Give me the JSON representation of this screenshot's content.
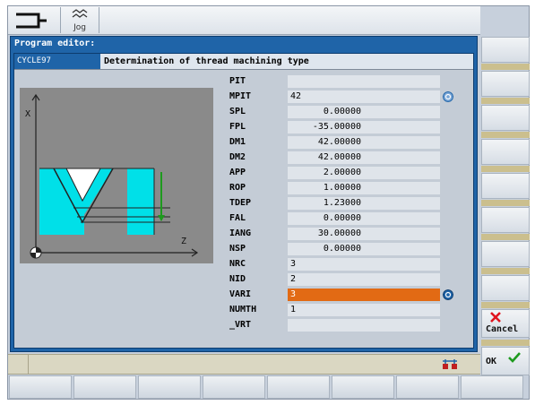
{
  "header": {
    "mode_label": "Jog"
  },
  "dialog": {
    "title": "Program editor:"
  },
  "cycle": {
    "name": "CYCLE97",
    "description": "Determination of thread machining type"
  },
  "params": [
    {
      "label": "PIT",
      "value": ""
    },
    {
      "label": "MPIT",
      "value": "42",
      "toggle": true
    },
    {
      "label": "SPL",
      "value": "0.00000",
      "numeric": true
    },
    {
      "label": "FPL",
      "value": "-35.00000",
      "numeric": true
    },
    {
      "label": "DM1",
      "value": "42.00000",
      "numeric": true
    },
    {
      "label": "DM2",
      "value": "42.00000",
      "numeric": true
    },
    {
      "label": "APP",
      "value": "2.00000",
      "numeric": true
    },
    {
      "label": "ROP",
      "value": "1.00000",
      "numeric": true
    },
    {
      "label": "TDEP",
      "value": "1.23000",
      "numeric": true
    },
    {
      "label": "FAL",
      "value": "0.00000",
      "numeric": true
    },
    {
      "label": "IANG",
      "value": "30.00000",
      "numeric": true
    },
    {
      "label": "NSP",
      "value": "0.00000",
      "numeric": true
    },
    {
      "label": "NRC",
      "value": "3"
    },
    {
      "label": "NID",
      "value": "2"
    },
    {
      "label": "VARI",
      "value": "3",
      "toggle": true,
      "active": true
    },
    {
      "label": "NUMTH",
      "value": "1"
    },
    {
      "label": "_VRT",
      "value": ""
    }
  ],
  "graphic": {
    "x_axis": "Z",
    "y_axis": "X"
  },
  "softkeys": {
    "cancel_label": "Cancel",
    "ok_label": "OK"
  },
  "colors": {
    "accent": "#1f64a8",
    "active_field": "#e26a14",
    "thread_fill": "#00e0e8",
    "cancel_x": "#e0141e",
    "ok_check": "#1e9a1e"
  },
  "icons": {
    "mode": "jog-mode-icon",
    "toggle": "toggle-icon",
    "status": "channel-status-icon",
    "cancel": "cross-icon",
    "ok": "checkmark-icon"
  }
}
